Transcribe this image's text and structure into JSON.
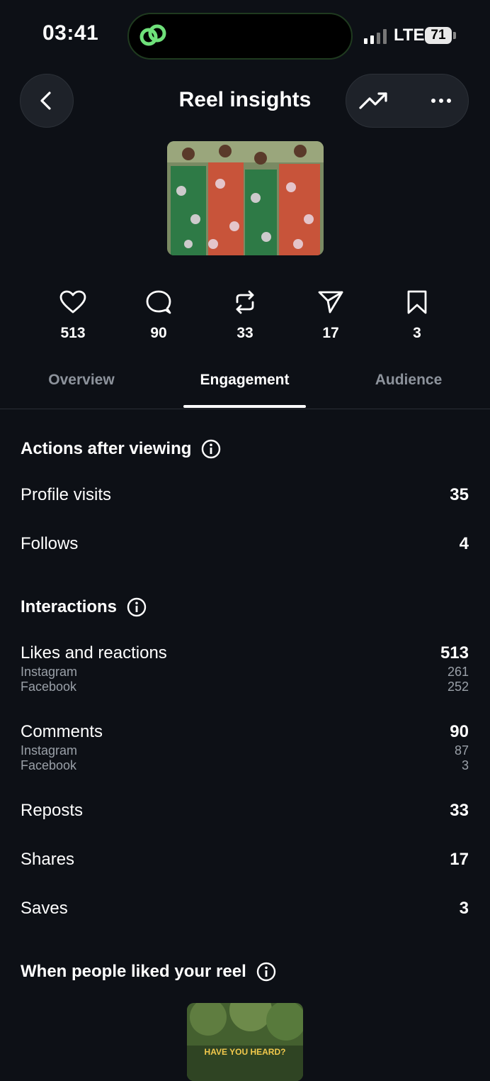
{
  "status_bar": {
    "time": "03:41",
    "network": "LTE",
    "battery": "71"
  },
  "header": {
    "title": "Reel insights",
    "back_icon": "chevron-left-icon",
    "trend_icon": "trending-up-icon",
    "more_icon": "more-horizontal-icon"
  },
  "reel_thumbnail": {
    "description_colors": [
      "#2e7a46",
      "#c8543a",
      "#e9d9e4"
    ]
  },
  "metrics": [
    {
      "icon": "heart-icon",
      "value": "513"
    },
    {
      "icon": "comment-icon",
      "value": "90"
    },
    {
      "icon": "repost-icon",
      "value": "33"
    },
    {
      "icon": "send-icon",
      "value": "17"
    },
    {
      "icon": "bookmark-icon",
      "value": "3"
    }
  ],
  "tabs": [
    {
      "label": "Overview",
      "active": false
    },
    {
      "label": "Engagement",
      "active": true
    },
    {
      "label": "Audience",
      "active": false
    }
  ],
  "actions_after_viewing": {
    "title": "Actions after viewing",
    "rows": [
      {
        "label": "Profile visits",
        "value": "35"
      },
      {
        "label": "Follows",
        "value": "4"
      }
    ]
  },
  "interactions": {
    "title": "Interactions",
    "likes": {
      "label": "Likes and reactions",
      "value": "513",
      "breakdown": [
        {
          "label": "Instagram",
          "value": "261"
        },
        {
          "label": "Facebook",
          "value": "252"
        }
      ]
    },
    "comments": {
      "label": "Comments",
      "value": "90",
      "breakdown": [
        {
          "label": "Instagram",
          "value": "87"
        },
        {
          "label": "Facebook",
          "value": "3"
        }
      ]
    },
    "rows": [
      {
        "label": "Reposts",
        "value": "33"
      },
      {
        "label": "Shares",
        "value": "17"
      },
      {
        "label": "Saves",
        "value": "3"
      }
    ]
  },
  "liked_section": {
    "title": "When people liked your reel",
    "thumbnail_caption": "HAVE YOU HEARD?"
  },
  "colors": {
    "background": "#0d1016",
    "muted_text": "#9aa0a8",
    "caption_yellow": "#f2c94c"
  }
}
